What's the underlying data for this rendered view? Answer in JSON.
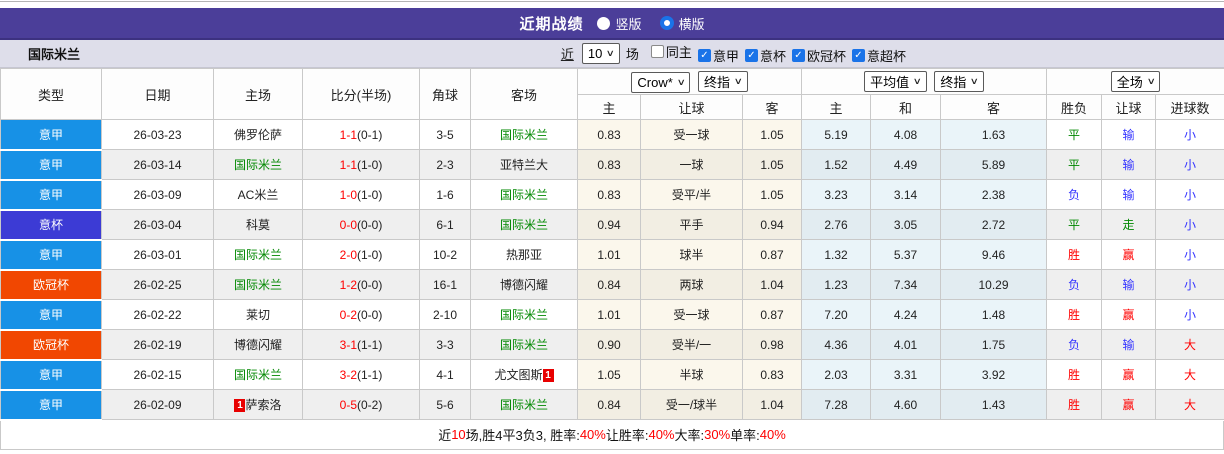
{
  "colors": {
    "bar": "#4b3e99",
    "league": {
      "意甲": "#1791e6",
      "意杯": "#3c3bd5",
      "欧冠杯": "#f14701"
    },
    "outcome": {
      "red": "#ff0000",
      "blue": "#3333ff",
      "green": "#008800"
    },
    "team_highlight": "#008800",
    "score": "#ff0000"
  },
  "titlebar": {
    "title": "近期战绩",
    "layout_options": [
      {
        "label": "竖版",
        "selected": false
      },
      {
        "label": "横版",
        "selected": true
      }
    ]
  },
  "filterbar": {
    "team": "国际米兰",
    "near": "近",
    "count": "10",
    "unit": "场",
    "checkboxes": [
      {
        "label": "同主",
        "checked": false
      },
      {
        "label": "意甲",
        "checked": true
      },
      {
        "label": "意杯",
        "checked": true
      },
      {
        "label": "欧冠杯",
        "checked": true
      },
      {
        "label": "意超杯",
        "checked": true
      }
    ]
  },
  "header": {
    "left": [
      "类型",
      "日期",
      "主场",
      "比分(半场)",
      "角球",
      "客场"
    ],
    "asia_src": "Crow*",
    "asia_idx": "终指",
    "euro_src": "平均值",
    "euro_idx": "终指",
    "scope": "全场",
    "cols": [
      "主",
      "让球",
      "客",
      "主",
      "和",
      "客",
      "胜负",
      "让球",
      "进球数"
    ]
  },
  "rows": [
    {
      "league": "意甲",
      "date": "26-03-23",
      "home": "佛罗伦萨",
      "home_green": false,
      "home_badge": "",
      "score": "1-1",
      "half": "(0-1)",
      "corner": "3-5",
      "away": "国际米兰",
      "away_green": true,
      "away_badge": "",
      "ah": "0.83",
      "handicap": "受一球",
      "aa": "1.05",
      "eh": "5.19",
      "ed": "4.08",
      "ea": "1.63",
      "res": "平",
      "res_c": "green",
      "hres": "输",
      "hres_c": "blue",
      "goals": "小",
      "goals_c": "blue"
    },
    {
      "league": "意甲",
      "date": "26-03-14",
      "home": "国际米兰",
      "home_green": true,
      "home_badge": "",
      "score": "1-1",
      "half": "(1-0)",
      "corner": "2-3",
      "away": "亚特兰大",
      "away_green": false,
      "away_badge": "",
      "ah": "0.83",
      "handicap": "一球",
      "aa": "1.05",
      "eh": "1.52",
      "ed": "4.49",
      "ea": "5.89",
      "res": "平",
      "res_c": "green",
      "hres": "输",
      "hres_c": "blue",
      "goals": "小",
      "goals_c": "blue"
    },
    {
      "league": "意甲",
      "date": "26-03-09",
      "home": "AC米兰",
      "home_green": false,
      "home_badge": "",
      "score": "1-0",
      "half": "(1-0)",
      "corner": "1-6",
      "away": "国际米兰",
      "away_green": true,
      "away_badge": "",
      "ah": "0.83",
      "handicap": "受平/半",
      "aa": "1.05",
      "eh": "3.23",
      "ed": "3.14",
      "ea": "2.38",
      "res": "负",
      "res_c": "blue",
      "hres": "输",
      "hres_c": "blue",
      "goals": "小",
      "goals_c": "blue"
    },
    {
      "league": "意杯",
      "date": "26-03-04",
      "home": "科莫",
      "home_green": false,
      "home_badge": "",
      "score": "0-0",
      "half": "(0-0)",
      "corner": "6-1",
      "away": "国际米兰",
      "away_green": true,
      "away_badge": "",
      "ah": "0.94",
      "handicap": "平手",
      "aa": "0.94",
      "eh": "2.76",
      "ed": "3.05",
      "ea": "2.72",
      "res": "平",
      "res_c": "green",
      "hres": "走",
      "hres_c": "green",
      "goals": "小",
      "goals_c": "blue"
    },
    {
      "league": "意甲",
      "date": "26-03-01",
      "home": "国际米兰",
      "home_green": true,
      "home_badge": "",
      "score": "2-0",
      "half": "(1-0)",
      "corner": "10-2",
      "away": "热那亚",
      "away_green": false,
      "away_badge": "",
      "ah": "1.01",
      "handicap": "球半",
      "aa": "0.87",
      "eh": "1.32",
      "ed": "5.37",
      "ea": "9.46",
      "res": "胜",
      "res_c": "red",
      "hres": "赢",
      "hres_c": "red",
      "goals": "小",
      "goals_c": "blue"
    },
    {
      "league": "欧冠杯",
      "date": "26-02-25",
      "home": "国际米兰",
      "home_green": true,
      "home_badge": "",
      "score": "1-2",
      "half": "(0-0)",
      "corner": "16-1",
      "away": "博德闪耀",
      "away_green": false,
      "away_badge": "",
      "ah": "0.84",
      "handicap": "两球",
      "aa": "1.04",
      "eh": "1.23",
      "ed": "7.34",
      "ea": "10.29",
      "res": "负",
      "res_c": "blue",
      "hres": "输",
      "hres_c": "blue",
      "goals": "小",
      "goals_c": "blue"
    },
    {
      "league": "意甲",
      "date": "26-02-22",
      "home": "莱切",
      "home_green": false,
      "home_badge": "",
      "score": "0-2",
      "half": "(0-0)",
      "corner": "2-10",
      "away": "国际米兰",
      "away_green": true,
      "away_badge": "",
      "ah": "1.01",
      "handicap": "受一球",
      "aa": "0.87",
      "eh": "7.20",
      "ed": "4.24",
      "ea": "1.48",
      "res": "胜",
      "res_c": "red",
      "hres": "赢",
      "hres_c": "red",
      "goals": "小",
      "goals_c": "blue"
    },
    {
      "league": "欧冠杯",
      "date": "26-02-19",
      "home": "博德闪耀",
      "home_green": false,
      "home_badge": "",
      "score": "3-1",
      "half": "(1-1)",
      "corner": "3-3",
      "away": "国际米兰",
      "away_green": true,
      "away_badge": "",
      "ah": "0.90",
      "handicap": "受半/一",
      "aa": "0.98",
      "eh": "4.36",
      "ed": "4.01",
      "ea": "1.75",
      "res": "负",
      "res_c": "blue",
      "hres": "输",
      "hres_c": "blue",
      "goals": "大",
      "goals_c": "red"
    },
    {
      "league": "意甲",
      "date": "26-02-15",
      "home": "国际米兰",
      "home_green": true,
      "home_badge": "",
      "score": "3-2",
      "half": "(1-1)",
      "corner": "4-1",
      "away": "尤文图斯",
      "away_green": false,
      "away_badge": "1",
      "ah": "1.05",
      "handicap": "半球",
      "aa": "0.83",
      "eh": "2.03",
      "ed": "3.31",
      "ea": "3.92",
      "res": "胜",
      "res_c": "red",
      "hres": "赢",
      "hres_c": "red",
      "goals": "大",
      "goals_c": "red"
    },
    {
      "league": "意甲",
      "date": "26-02-09",
      "home": "萨索洛",
      "home_green": false,
      "home_badge": "1",
      "score": "0-5",
      "half": "(0-2)",
      "corner": "5-6",
      "away": "国际米兰",
      "away_green": true,
      "away_badge": "",
      "ah": "0.84",
      "handicap": "受一/球半",
      "aa": "1.04",
      "eh": "7.28",
      "ed": "4.60",
      "ea": "1.43",
      "res": "胜",
      "res_c": "red",
      "hres": "赢",
      "hres_c": "red",
      "goals": "大",
      "goals_c": "red"
    }
  ],
  "summary": {
    "segments": [
      {
        "text": "近",
        "red": false
      },
      {
        "text": "10",
        "red": true
      },
      {
        "text": "场,胜4平3负3, 胜率:",
        "red": false
      },
      {
        "text": "40%",
        "red": true
      },
      {
        "text": " 让胜率:",
        "red": false
      },
      {
        "text": "40%",
        "red": true
      },
      {
        "text": " 大率:",
        "red": false
      },
      {
        "text": "30%",
        "red": true
      },
      {
        "text": " 单率:",
        "red": false
      },
      {
        "text": "40%",
        "red": true
      }
    ]
  }
}
